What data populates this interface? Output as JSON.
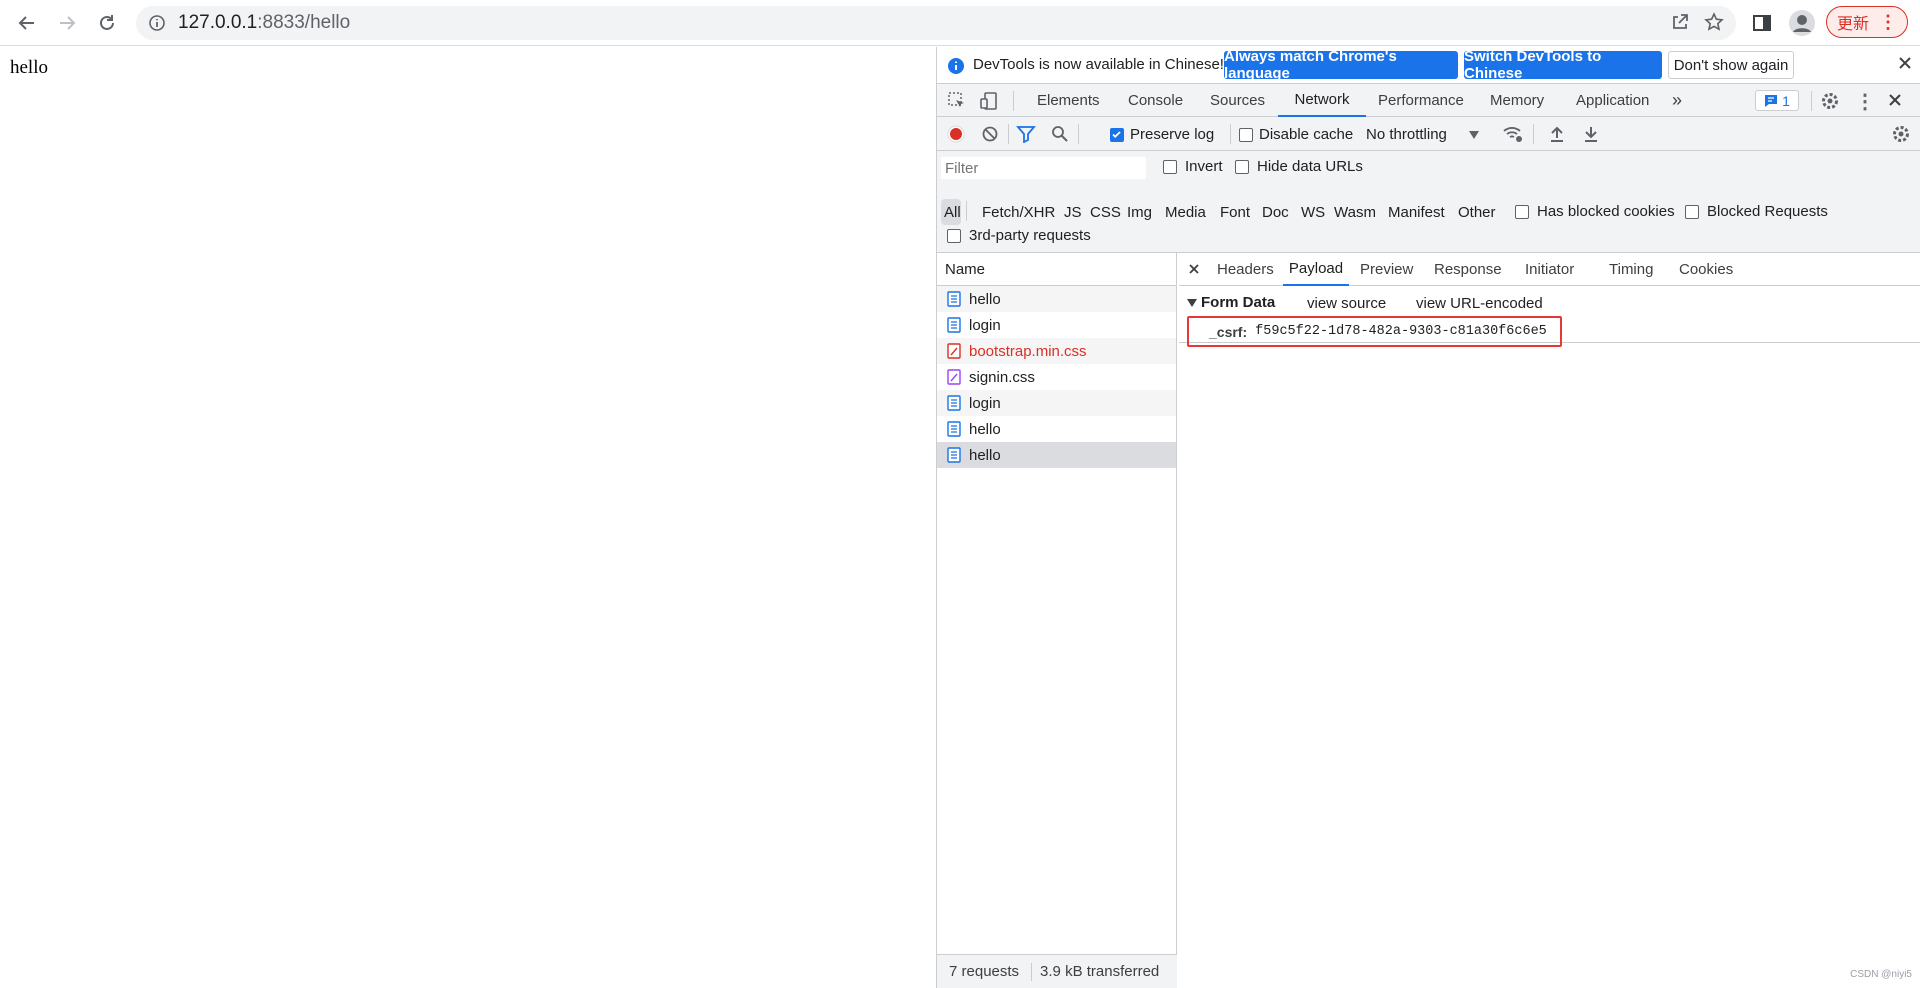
{
  "browser": {
    "url_host": "127.0.0.1",
    "url_rest": ":8833/hello",
    "update_label": "更新"
  },
  "page": {
    "body_text": "hello"
  },
  "devtools": {
    "infobar": {
      "message": "DevTools is now available in Chinese!",
      "match_button": "Always match Chrome's language",
      "switch_button": "Switch DevTools to Chinese",
      "dismiss_button": "Don't show again"
    },
    "tabs": [
      "Elements",
      "Console",
      "Sources",
      "Network",
      "Performance",
      "Memory",
      "Application"
    ],
    "active_tab": "Network",
    "issues_count": "1",
    "toolbar": {
      "preserve_log": "Preserve log",
      "disable_cache": "Disable cache",
      "throttling": "No throttling"
    },
    "filter": {
      "placeholder": "Filter",
      "invert": "Invert",
      "hide_data_urls": "Hide data URLs",
      "types": [
        "All",
        "Fetch/XHR",
        "JS",
        "CSS",
        "Img",
        "Media",
        "Font",
        "Doc",
        "WS",
        "Wasm",
        "Manifest",
        "Other"
      ],
      "has_blocked_cookies": "Has blocked cookies",
      "blocked_requests": "Blocked Requests",
      "third_party": "3rd-party requests"
    },
    "requests": {
      "header": "Name",
      "items": [
        {
          "name": "hello",
          "kind": "doc"
        },
        {
          "name": "login",
          "kind": "doc"
        },
        {
          "name": "bootstrap.min.css",
          "kind": "css-error"
        },
        {
          "name": "signin.css",
          "kind": "css"
        },
        {
          "name": "login",
          "kind": "doc"
        },
        {
          "name": "hello",
          "kind": "doc"
        },
        {
          "name": "hello",
          "kind": "doc"
        }
      ],
      "summary_count": "7 requests",
      "summary_transferred": "3.9 kB transferred"
    },
    "detail": {
      "tabs": [
        "Headers",
        "Payload",
        "Preview",
        "Response",
        "Initiator",
        "Timing",
        "Cookies"
      ],
      "active_tab": "Payload",
      "section_title": "Form Data",
      "view_source": "view source",
      "view_url_encoded": "view URL-encoded",
      "field_key": "_csrf:",
      "field_value": "f59c5f22-1d78-482a-9303-c81a30f6c6e5"
    }
  },
  "watermark": "CSDN @niyi5"
}
